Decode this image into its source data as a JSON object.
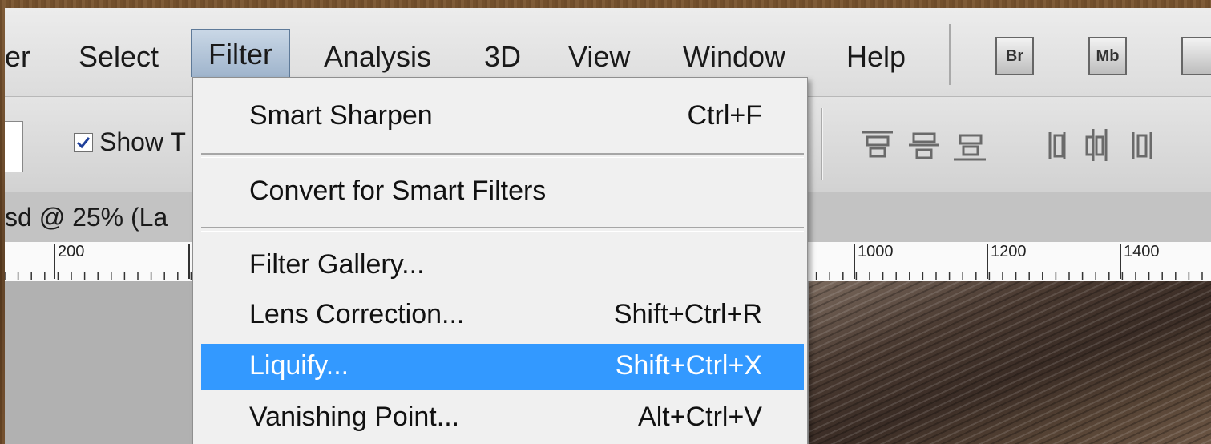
{
  "menubar": {
    "items": [
      {
        "label": "er"
      },
      {
        "label": "Select"
      },
      {
        "label": "Filter"
      },
      {
        "label": "Analysis"
      },
      {
        "label": "3D"
      },
      {
        "label": "View"
      },
      {
        "label": "Window"
      },
      {
        "label": "Help"
      }
    ],
    "bridge_label": "Br",
    "minibridge_label": "Mb"
  },
  "options": {
    "show_label": "Show T"
  },
  "document": {
    "title": "sd @ 25% (La"
  },
  "ruler": {
    "labels": [
      "200",
      "1000",
      "1200",
      "1400"
    ]
  },
  "filter_menu": {
    "items": [
      {
        "label": "Smart Sharpen",
        "shortcut": "Ctrl+F"
      },
      {
        "label": "Convert for Smart Filters",
        "shortcut": ""
      },
      {
        "label": "Filter Gallery...",
        "shortcut": ""
      },
      {
        "label": "Lens Correction...",
        "shortcut": "Shift+Ctrl+R"
      },
      {
        "label": "Liquify...",
        "shortcut": "Shift+Ctrl+X"
      },
      {
        "label": "Vanishing Point...",
        "shortcut": "Alt+Ctrl+V"
      }
    ],
    "highlighted": "Liquify..."
  },
  "colors": {
    "highlight": "#3399ff",
    "menu_bg": "#f0f0f0"
  }
}
